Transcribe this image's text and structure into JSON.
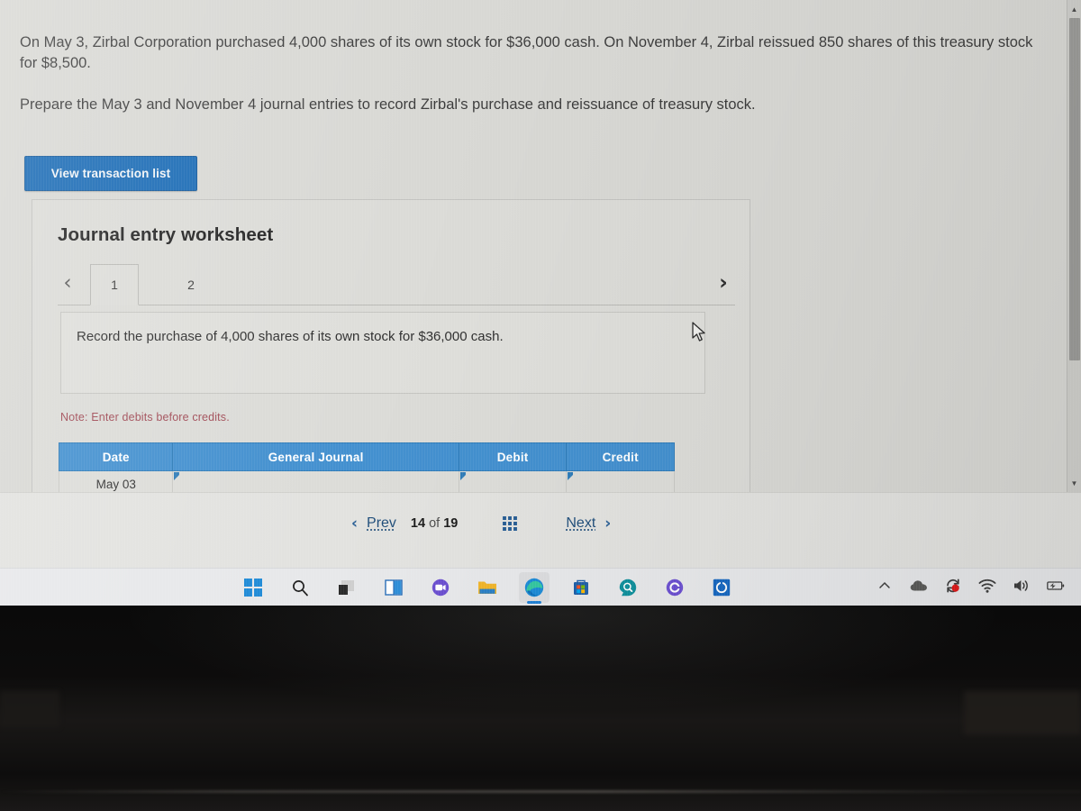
{
  "problem": {
    "paragraph_1": "On May 3, Zirbal Corporation purchased 4,000 shares of its own stock for $36,000 cash. On November 4, Zirbal reissued 850 shares of this treasury stock for $8,500.",
    "paragraph_2": "Prepare the May 3 and November 4 journal entries to record Zirbal's purchase and reissuance of treasury stock."
  },
  "buttons": {
    "view_transaction_list": "View transaction list"
  },
  "worksheet": {
    "title": "Journal entry worksheet",
    "prev_arrow": "‹",
    "next_arrow": "›",
    "tabs": [
      {
        "label": "1",
        "active": true
      },
      {
        "label": "2",
        "active": false
      }
    ],
    "instruction": "Record the purchase of 4,000 shares of its own stock for $36,000 cash.",
    "note": "Note: Enter debits before credits."
  },
  "journal_table": {
    "headers": [
      "Date",
      "General Journal",
      "Debit",
      "Credit"
    ],
    "rows": [
      {
        "date": "May 03",
        "general_journal": "",
        "debit": "",
        "credit": ""
      }
    ]
  },
  "pagination": {
    "prev_chevron": "‹",
    "prev_label": "Prev",
    "current_page": "14",
    "of_label": "of",
    "total_pages": "19",
    "grid_icon": "grid-view-icon",
    "next_label": "Next",
    "next_chevron": "›"
  },
  "scrollbar": {
    "up_arrow": "▲",
    "down_arrow": "▼"
  },
  "taskbar": {
    "items": [
      {
        "name": "start-icon",
        "active": false
      },
      {
        "name": "search-icon",
        "active": false
      },
      {
        "name": "task-view-icon",
        "active": false
      },
      {
        "name": "widgets-icon",
        "active": false
      },
      {
        "name": "microsoft-teams-icon",
        "active": false
      },
      {
        "name": "file-explorer-icon",
        "active": false
      },
      {
        "name": "microsoft-edge-icon",
        "active": true
      },
      {
        "name": "microsoft-store-icon",
        "active": false
      },
      {
        "name": "search-app-icon",
        "active": false
      },
      {
        "name": "purple-app-icon",
        "active": false
      },
      {
        "name": "blue-app-icon",
        "active": false
      }
    ],
    "tray": [
      {
        "name": "show-hidden-icons-chevron"
      },
      {
        "name": "onedrive-cloud-icon"
      },
      {
        "name": "sync-recording-icon"
      },
      {
        "name": "wifi-icon"
      },
      {
        "name": "volume-icon"
      },
      {
        "name": "battery-charging-icon"
      }
    ]
  },
  "colors": {
    "accent_button_blue": "#1a6bb5",
    "table_header_blue": "#4390cf",
    "note_red": "#a04a55",
    "link_blue": "#1f4d7a",
    "page_background": "#d8d8d4"
  }
}
